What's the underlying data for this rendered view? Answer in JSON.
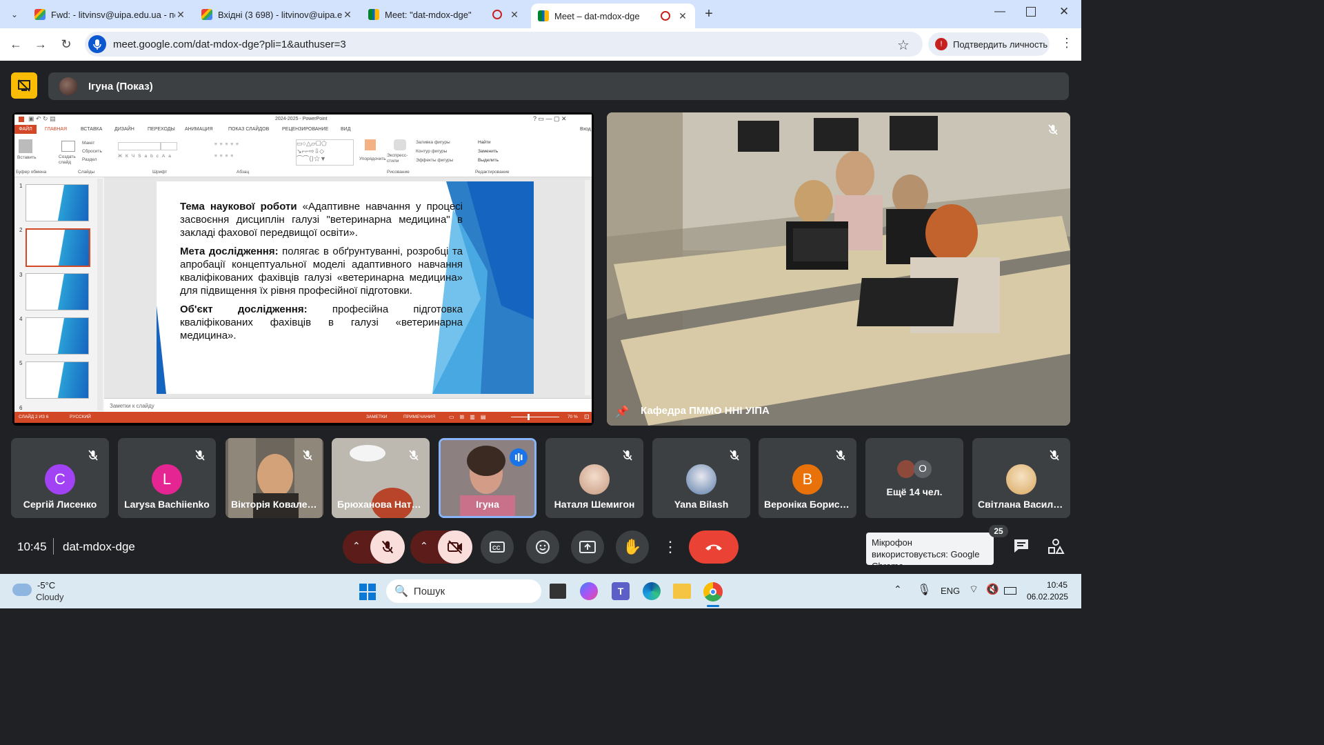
{
  "browser": {
    "tabs": [
      {
        "title": "Fwd: - litvinsv@uipa.edu.ua - по",
        "favicon": "gmail-icon"
      },
      {
        "title": "Вхідні (3 698) - litvinov@uipa.e",
        "favicon": "gmail-icon"
      },
      {
        "title": "Meet: \"dat-mdox-dge\"",
        "favicon": "meet-icon"
      },
      {
        "title": "Meet – dat-mdox-dge",
        "favicon": "meet-icon",
        "active": true
      }
    ],
    "url": "meet.google.com/dat-mdox-dge?pli=1&authuser=3",
    "verify_button": "Подтвердить личность"
  },
  "meet": {
    "presenter_label": "Ігуна (Показ)",
    "room_tile_name": "Кафедра ПММО ННІ УІПА",
    "time": "10:45",
    "meeting_code": "dat-mdox-dge",
    "participant_count": "25",
    "mic_tooltip": "Мікрофон використовується: Google Chrome",
    "participants": [
      {
        "name": "Сергій Лисенко",
        "initial": "С",
        "color": "#a142f4"
      },
      {
        "name": "Larysa Bachiienko",
        "initial": "L",
        "color": "#e52592"
      },
      {
        "name": "Вікторія Коваленко",
        "initial": "",
        "color": "#6b5a4e"
      },
      {
        "name": "Брюханова Наталія",
        "initial": "",
        "color": "#c9b8a8"
      },
      {
        "name": "Ігуна",
        "initial": "",
        "color": "#7a6a66"
      },
      {
        "name": "Наталя Шемигон",
        "initial": "",
        "color": "#e8d4c4"
      },
      {
        "name": "Yana Bilash",
        "initial": "",
        "color": "#5c7ea8"
      },
      {
        "name": "Вероніка Борисова",
        "initial": "В",
        "color": "#e8710a"
      },
      {
        "name": "Ещё 14 чел.",
        "initial": "O",
        "color": "#5f6368"
      },
      {
        "name": "Світлана Васильченко",
        "initial": "",
        "color": "#e8c89c"
      }
    ]
  },
  "powerpoint": {
    "title": "2024-2025 - PowerPoint",
    "ribbon_tabs": [
      "ФАЙЛ",
      "ГЛАВНАЯ",
      "ВСТАВКА",
      "ДИЗАЙН",
      "ПЕРЕХОДЫ",
      "АНИМАЦИЯ",
      "ПОКАЗ СЛАЙДОВ",
      "РЕЦЕНЗИРОВАНИЕ",
      "ВИД"
    ],
    "signin": "Вход",
    "groups": [
      "Буфер обмена",
      "Слайды",
      "Шрифт",
      "Абзац",
      "Рисование",
      "Редактирование"
    ],
    "edit_items": [
      "Найти",
      "Заменить",
      "Выделить"
    ],
    "slide_items": [
      "Макет",
      "Сбросить",
      "Раздел"
    ],
    "new_slide": "Создать слайд",
    "paste": "Вставить",
    "arrange": "Упорядочить",
    "styles": "Экспресс-стили",
    "shape_items": [
      "Заливка фигуры",
      "Контур фигуры",
      "Эффекты фигуры"
    ],
    "slide_numbers": [
      "1",
      "2",
      "3",
      "4",
      "5",
      "6"
    ],
    "notes_placeholder": "Заметки к слайду",
    "status_slide": "СЛАЙД 2 ИЗ 6",
    "status_lang": "РУССКИЙ",
    "status_notes": "ЗАМЕТКИ",
    "status_comments": "ПРИМЕЧАНИЯ",
    "zoom": "70 %",
    "slide_text": {
      "p1_bold1": "Тема",
      "p1_bold2": "наукової роботи",
      "p1_rest": "«Адаптивне навчання у процесі засвоєння дисциплін галузі \"ветеринарна медицина\" в закладі фахової передвищої освіти».",
      "p2_bold": "Мета дослідження:",
      "p2_rest": "полягає в обґрунтуванні, розробці та апробації концептуальної моделі адаптивного навчання кваліфікованих фахівців галузі «ветеринарна медицина» для підвищення їх рівня професійної підготовки.",
      "p3_bold": "Об'єкт дослідження:",
      "p3_rest": "професійна підготовка кваліфікованих фахівців в галузі «ветеринарна медицина»."
    }
  },
  "taskbar": {
    "temp": "-5°C",
    "weather": "Cloudy",
    "search": "Пошук",
    "lang": "ENG",
    "time": "10:45",
    "date": "06.02.2025"
  }
}
